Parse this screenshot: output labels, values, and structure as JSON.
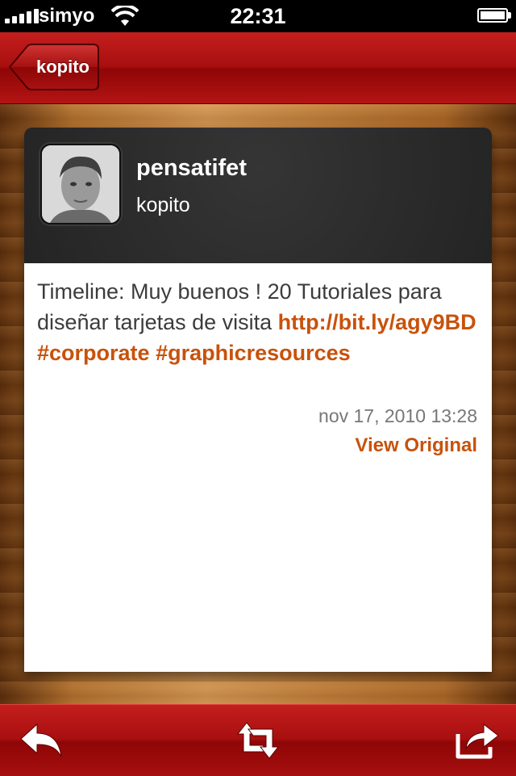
{
  "status_bar": {
    "carrier": "simyo",
    "time": "22:31",
    "battery_level": 0.95,
    "signal_bars": 5
  },
  "nav_bar": {
    "back_label": "kopito"
  },
  "tweet": {
    "user": {
      "username": "pensatifet",
      "screen_name": "kopito",
      "avatar_icon": "user-photo"
    },
    "text": "Timeline: Muy buenos ! 20 Tutoriales para diseñar tarjetas de visita",
    "link": "http://bit.ly/agy9BD",
    "hashtags": [
      "#corporate",
      "#graphicresources"
    ],
    "timestamp": "nov 17, 2010 13:28",
    "view_original_label": "View Original"
  },
  "toolbar": {
    "items": [
      {
        "icon": "reply-icon"
      },
      {
        "icon": "retweet-icon"
      },
      {
        "icon": "share-icon"
      }
    ]
  },
  "colors": {
    "accent_red": "#b41414",
    "link_orange": "#c8520c",
    "header_dark": "#2a2a2a"
  }
}
